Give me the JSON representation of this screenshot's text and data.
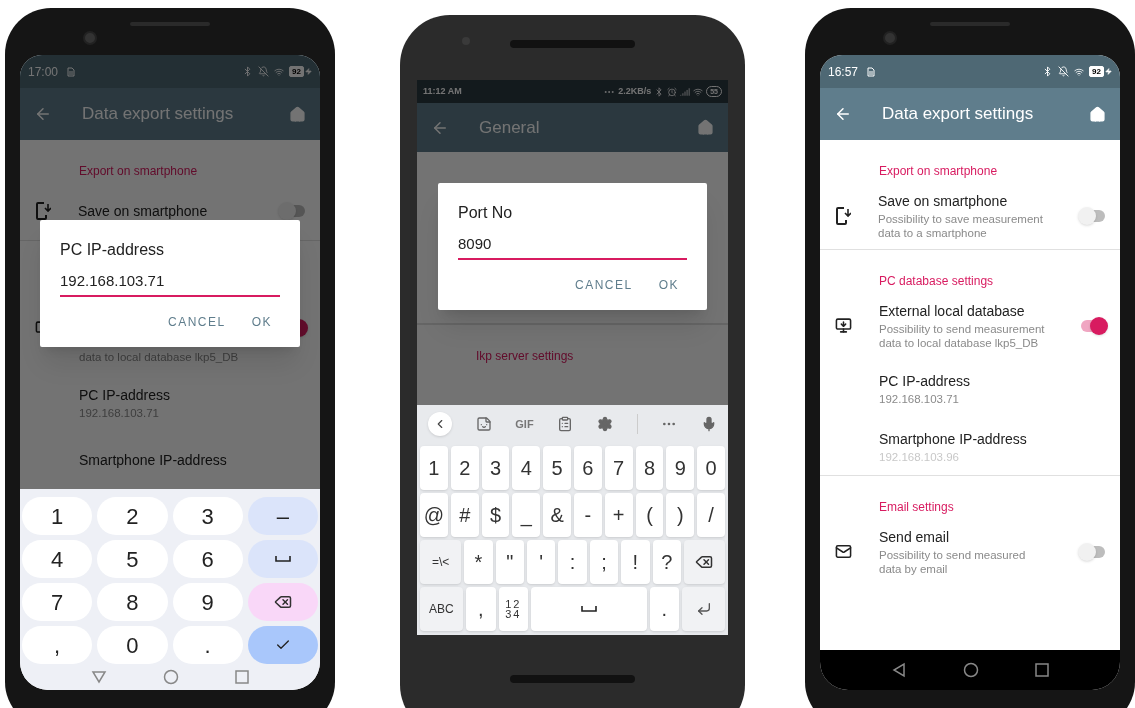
{
  "phones": [
    {
      "status_bar": {
        "kind": "stock",
        "time": "17:00",
        "battery": "92"
      },
      "app_bar": {
        "title": "Data export settings"
      },
      "sections": [
        {
          "kind": "list",
          "header": "Export on smartphone",
          "items": [
            {
              "kind": "phone",
              "title": "Save on smartphone",
              "on": false
            }
          ]
        },
        {
          "kind": "list",
          "items": [
            {
              "kind": "monitor",
              "subtitle": [
                "data to local database lkp5_DB"
              ],
              "on": true
            },
            {
              "kind": "plain",
              "title": "PC IP-address",
              "subtitle": [
                "192.168.103.71"
              ]
            },
            {
              "kind": "plain",
              "title": "Smartphone IP-address"
            }
          ]
        }
      ],
      "dialog": {
        "title": "PC IP-address",
        "value": "192.168.103.71",
        "buttons": [
          "CANCEL",
          "OK"
        ]
      },
      "keyboard": {
        "kind": "numpad",
        "rows": [
          [
            {
              "kind": "text",
              "label": "1"
            },
            {
              "kind": "text",
              "label": "2"
            },
            {
              "kind": "text",
              "label": "3"
            },
            {
              "kind": "action",
              "label": "–"
            }
          ],
          [
            {
              "kind": "text",
              "label": "4"
            },
            {
              "kind": "text",
              "label": "5"
            },
            {
              "kind": "text",
              "label": "6"
            },
            {
              "kind": "space"
            }
          ],
          [
            {
              "kind": "text",
              "label": "7"
            },
            {
              "kind": "text",
              "label": "8"
            },
            {
              "kind": "text",
              "label": "9"
            },
            {
              "kind": "backspace"
            }
          ],
          [
            {
              "kind": "text",
              "label": ","
            },
            {
              "kind": "text",
              "label": "0"
            },
            {
              "kind": "text",
              "label": "."
            },
            {
              "kind": "done"
            }
          ]
        ]
      },
      "nav_bar": {
        "kind": "light"
      }
    },
    {
      "status_bar": {
        "kind": "miui",
        "time": "11:12 AM",
        "speed": "2.2KB/s",
        "battery": "55"
      },
      "app_bar": {
        "title": "General"
      },
      "sections": [
        {
          "kind": "covered"
        },
        {
          "kind": "list",
          "header": "Ikp server settings"
        }
      ],
      "dialog": {
        "title": "Port No",
        "value": "8090",
        "buttons": [
          "CANCEL",
          "OK"
        ]
      },
      "keyboard": {
        "kind": "full",
        "toolbar": [
          {
            "kind": "back"
          },
          {
            "kind": "sticker"
          },
          {
            "kind": "text",
            "label": "GIF"
          },
          {
            "kind": "clipboard"
          },
          {
            "kind": "settings"
          },
          {
            "kind": "divider"
          },
          {
            "kind": "more"
          },
          {
            "kind": "mic"
          }
        ],
        "rows": [
          [
            {
              "kind": "text",
              "label": "1"
            },
            {
              "kind": "text",
              "label": "2"
            },
            {
              "kind": "text",
              "label": "3"
            },
            {
              "kind": "text",
              "label": "4"
            },
            {
              "kind": "text",
              "label": "5"
            },
            {
              "kind": "text",
              "label": "6"
            },
            {
              "kind": "text",
              "label": "7"
            },
            {
              "kind": "text",
              "label": "8"
            },
            {
              "kind": "text",
              "label": "9"
            },
            {
              "kind": "text",
              "label": "0"
            }
          ],
          [
            {
              "kind": "text",
              "label": "@"
            },
            {
              "kind": "text",
              "label": "#"
            },
            {
              "kind": "text",
              "label": "$"
            },
            {
              "kind": "text",
              "label": "_"
            },
            {
              "kind": "text",
              "label": "&"
            },
            {
              "kind": "text",
              "label": "-"
            },
            {
              "kind": "text",
              "label": "+"
            },
            {
              "kind": "text",
              "label": "("
            },
            {
              "kind": "text",
              "label": ")"
            },
            {
              "kind": "text",
              "label": "/"
            }
          ],
          [
            {
              "kind": "mode",
              "label": "=\\<"
            },
            {
              "kind": "text",
              "label": "*"
            },
            {
              "kind": "text",
              "label": "\""
            },
            {
              "kind": "text",
              "label": "'"
            },
            {
              "kind": "text",
              "label": ":"
            },
            {
              "kind": "text",
              "label": ";"
            },
            {
              "kind": "text",
              "label": "!"
            },
            {
              "kind": "text",
              "label": "?"
            },
            {
              "kind": "backspace"
            }
          ],
          [
            {
              "kind": "mode",
              "label": "ABC"
            },
            {
              "kind": "text",
              "label": ","
            },
            {
              "kind": "numsym",
              "label": "12\n34"
            },
            {
              "kind": "space"
            },
            {
              "kind": "text",
              "label": "."
            },
            {
              "kind": "enter"
            }
          ]
        ]
      }
    },
    {
      "status_bar": {
        "kind": "stock",
        "time": "16:57",
        "battery": "92"
      },
      "app_bar": {
        "title": "Data export settings"
      },
      "sections": [
        {
          "kind": "list",
          "header": "Export on smartphone",
          "items": [
            {
              "kind": "phone",
              "title": "Save on smartphone",
              "subtitle": [
                "Possibility to save measurement",
                "data to a smartphone"
              ],
              "on": false
            }
          ]
        },
        {
          "kind": "list",
          "header": "PC database settings",
          "items": [
            {
              "kind": "monitor",
              "title": "External local database",
              "subtitle": [
                "Possibility to send measurement",
                "data to local database lkp5_DB"
              ],
              "on": true
            },
            {
              "kind": "plain",
              "title": "PC IP-address",
              "subtitle": [
                "192.168.103.71"
              ],
              "disabled": false
            },
            {
              "kind": "plain",
              "title": "Smartphone IP-address",
              "subtitle": [
                "192.168.103.96"
              ],
              "disabled": true
            }
          ]
        },
        {
          "kind": "list",
          "header": "Email settings",
          "items": [
            {
              "kind": "mail",
              "title": "Send email",
              "subtitle": [
                "Possibility to send measured",
                "data by email"
              ],
              "on": false
            }
          ]
        }
      ],
      "nav_bar": {
        "kind": "dark"
      }
    }
  ]
}
